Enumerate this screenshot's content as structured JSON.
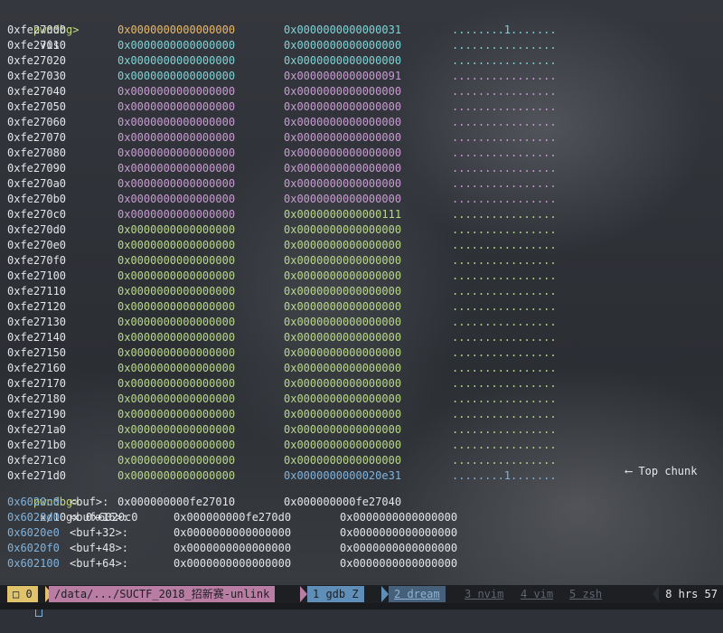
{
  "prompt_label": "pwndbg>",
  "cmd1": "vis",
  "vis_rows": [
    {
      "addr": "0xfe27000",
      "v1": "0x0000000000000000",
      "v2": "0x0000000000000031",
      "ascii": "........1.......",
      "c1": "orange",
      "c2": "teal"
    },
    {
      "addr": "0xfe27010",
      "v1": "0x0000000000000000",
      "v2": "0x0000000000000000",
      "ascii": "................",
      "c1": "teal",
      "c2": "teal"
    },
    {
      "addr": "0xfe27020",
      "v1": "0x0000000000000000",
      "v2": "0x0000000000000000",
      "ascii": "................",
      "c1": "teal",
      "c2": "teal"
    },
    {
      "addr": "0xfe27030",
      "v1": "0x0000000000000000",
      "v2": "0x0000000000000091",
      "ascii": "................",
      "c1": "teal",
      "c2": "purple"
    },
    {
      "addr": "0xfe27040",
      "v1": "0x0000000000000000",
      "v2": "0x0000000000000000",
      "ascii": "................",
      "c1": "purple",
      "c2": "purple"
    },
    {
      "addr": "0xfe27050",
      "v1": "0x0000000000000000",
      "v2": "0x0000000000000000",
      "ascii": "................",
      "c1": "purple",
      "c2": "purple"
    },
    {
      "addr": "0xfe27060",
      "v1": "0x0000000000000000",
      "v2": "0x0000000000000000",
      "ascii": "................",
      "c1": "purple",
      "c2": "purple"
    },
    {
      "addr": "0xfe27070",
      "v1": "0x0000000000000000",
      "v2": "0x0000000000000000",
      "ascii": "................",
      "c1": "purple",
      "c2": "purple"
    },
    {
      "addr": "0xfe27080",
      "v1": "0x0000000000000000",
      "v2": "0x0000000000000000",
      "ascii": "................",
      "c1": "purple",
      "c2": "purple"
    },
    {
      "addr": "0xfe27090",
      "v1": "0x0000000000000000",
      "v2": "0x0000000000000000",
      "ascii": "................",
      "c1": "purple",
      "c2": "purple"
    },
    {
      "addr": "0xfe270a0",
      "v1": "0x0000000000000000",
      "v2": "0x0000000000000000",
      "ascii": "................",
      "c1": "purple",
      "c2": "purple"
    },
    {
      "addr": "0xfe270b0",
      "v1": "0x0000000000000000",
      "v2": "0x0000000000000000",
      "ascii": "................",
      "c1": "purple",
      "c2": "purple"
    },
    {
      "addr": "0xfe270c0",
      "v1": "0x0000000000000000",
      "v2": "0x0000000000000111",
      "ascii": "................",
      "c1": "purple",
      "c2": "green"
    },
    {
      "addr": "0xfe270d0",
      "v1": "0x0000000000000000",
      "v2": "0x0000000000000000",
      "ascii": "................",
      "c1": "green",
      "c2": "green"
    },
    {
      "addr": "0xfe270e0",
      "v1": "0x0000000000000000",
      "v2": "0x0000000000000000",
      "ascii": "................",
      "c1": "green",
      "c2": "green"
    },
    {
      "addr": "0xfe270f0",
      "v1": "0x0000000000000000",
      "v2": "0x0000000000000000",
      "ascii": "................",
      "c1": "green",
      "c2": "green"
    },
    {
      "addr": "0xfe27100",
      "v1": "0x0000000000000000",
      "v2": "0x0000000000000000",
      "ascii": "................",
      "c1": "green",
      "c2": "green"
    },
    {
      "addr": "0xfe27110",
      "v1": "0x0000000000000000",
      "v2": "0x0000000000000000",
      "ascii": "................",
      "c1": "green",
      "c2": "green"
    },
    {
      "addr": "0xfe27120",
      "v1": "0x0000000000000000",
      "v2": "0x0000000000000000",
      "ascii": "................",
      "c1": "green",
      "c2": "green"
    },
    {
      "addr": "0xfe27130",
      "v1": "0x0000000000000000",
      "v2": "0x0000000000000000",
      "ascii": "................",
      "c1": "green",
      "c2": "green"
    },
    {
      "addr": "0xfe27140",
      "v1": "0x0000000000000000",
      "v2": "0x0000000000000000",
      "ascii": "................",
      "c1": "green",
      "c2": "green"
    },
    {
      "addr": "0xfe27150",
      "v1": "0x0000000000000000",
      "v2": "0x0000000000000000",
      "ascii": "................",
      "c1": "green",
      "c2": "green"
    },
    {
      "addr": "0xfe27160",
      "v1": "0x0000000000000000",
      "v2": "0x0000000000000000",
      "ascii": "................",
      "c1": "green",
      "c2": "green"
    },
    {
      "addr": "0xfe27170",
      "v1": "0x0000000000000000",
      "v2": "0x0000000000000000",
      "ascii": "................",
      "c1": "green",
      "c2": "green"
    },
    {
      "addr": "0xfe27180",
      "v1": "0x0000000000000000",
      "v2": "0x0000000000000000",
      "ascii": "................",
      "c1": "green",
      "c2": "green"
    },
    {
      "addr": "0xfe27190",
      "v1": "0x0000000000000000",
      "v2": "0x0000000000000000",
      "ascii": "................",
      "c1": "green",
      "c2": "green"
    },
    {
      "addr": "0xfe271a0",
      "v1": "0x0000000000000000",
      "v2": "0x0000000000000000",
      "ascii": "................",
      "c1": "green",
      "c2": "green"
    },
    {
      "addr": "0xfe271b0",
      "v1": "0x0000000000000000",
      "v2": "0x0000000000000000",
      "ascii": "................",
      "c1": "green",
      "c2": "green"
    },
    {
      "addr": "0xfe271c0",
      "v1": "0x0000000000000000",
      "v2": "0x0000000000000000",
      "ascii": "................",
      "c1": "green",
      "c2": "green"
    },
    {
      "addr": "0xfe271d0",
      "v1": "0x0000000000000000",
      "v2": "0x0000000000020e31",
      "ascii": "........1.......",
      "c1": "green",
      "c2": "blue"
    }
  ],
  "top_chunk_label": "⟵ Top chunk",
  "cmd2": "x/10gx 0x6020c0",
  "x_rows": [
    {
      "addr": "0x6020c0",
      "sym": "<buf>:",
      "v1": "0x000000000fe27010",
      "v2": "0x000000000fe27040"
    },
    {
      "addr": "0x6020d0",
      "sym": "<buf+16>:",
      "v1": "0x000000000fe270d0",
      "v2": "0x0000000000000000"
    },
    {
      "addr": "0x6020e0",
      "sym": "<buf+32>:",
      "v1": "0x0000000000000000",
      "v2": "0x0000000000000000"
    },
    {
      "addr": "0x6020f0",
      "sym": "<buf+48>:",
      "v1": "0x0000000000000000",
      "v2": "0x0000000000000000"
    },
    {
      "addr": "0x602100",
      "sym": "<buf+64>:",
      "v1": "0x0000000000000000",
      "v2": "0x0000000000000000"
    }
  ],
  "status": {
    "session": "□ 0",
    "path": "/data/.../SUCTF_2018_招新赛-unlink",
    "win1": "1 gdb Z",
    "win2": "2 dream",
    "win3": "3 nvim",
    "win4": "4 vim",
    "win5": "5 zsh",
    "time": "8 hrs 57"
  },
  "colors": {
    "orange": "#e8b86a",
    "teal": "#7fd3d6",
    "purple": "#c99bd3",
    "green": "#b9d88a",
    "blue": "#7fb3de"
  }
}
